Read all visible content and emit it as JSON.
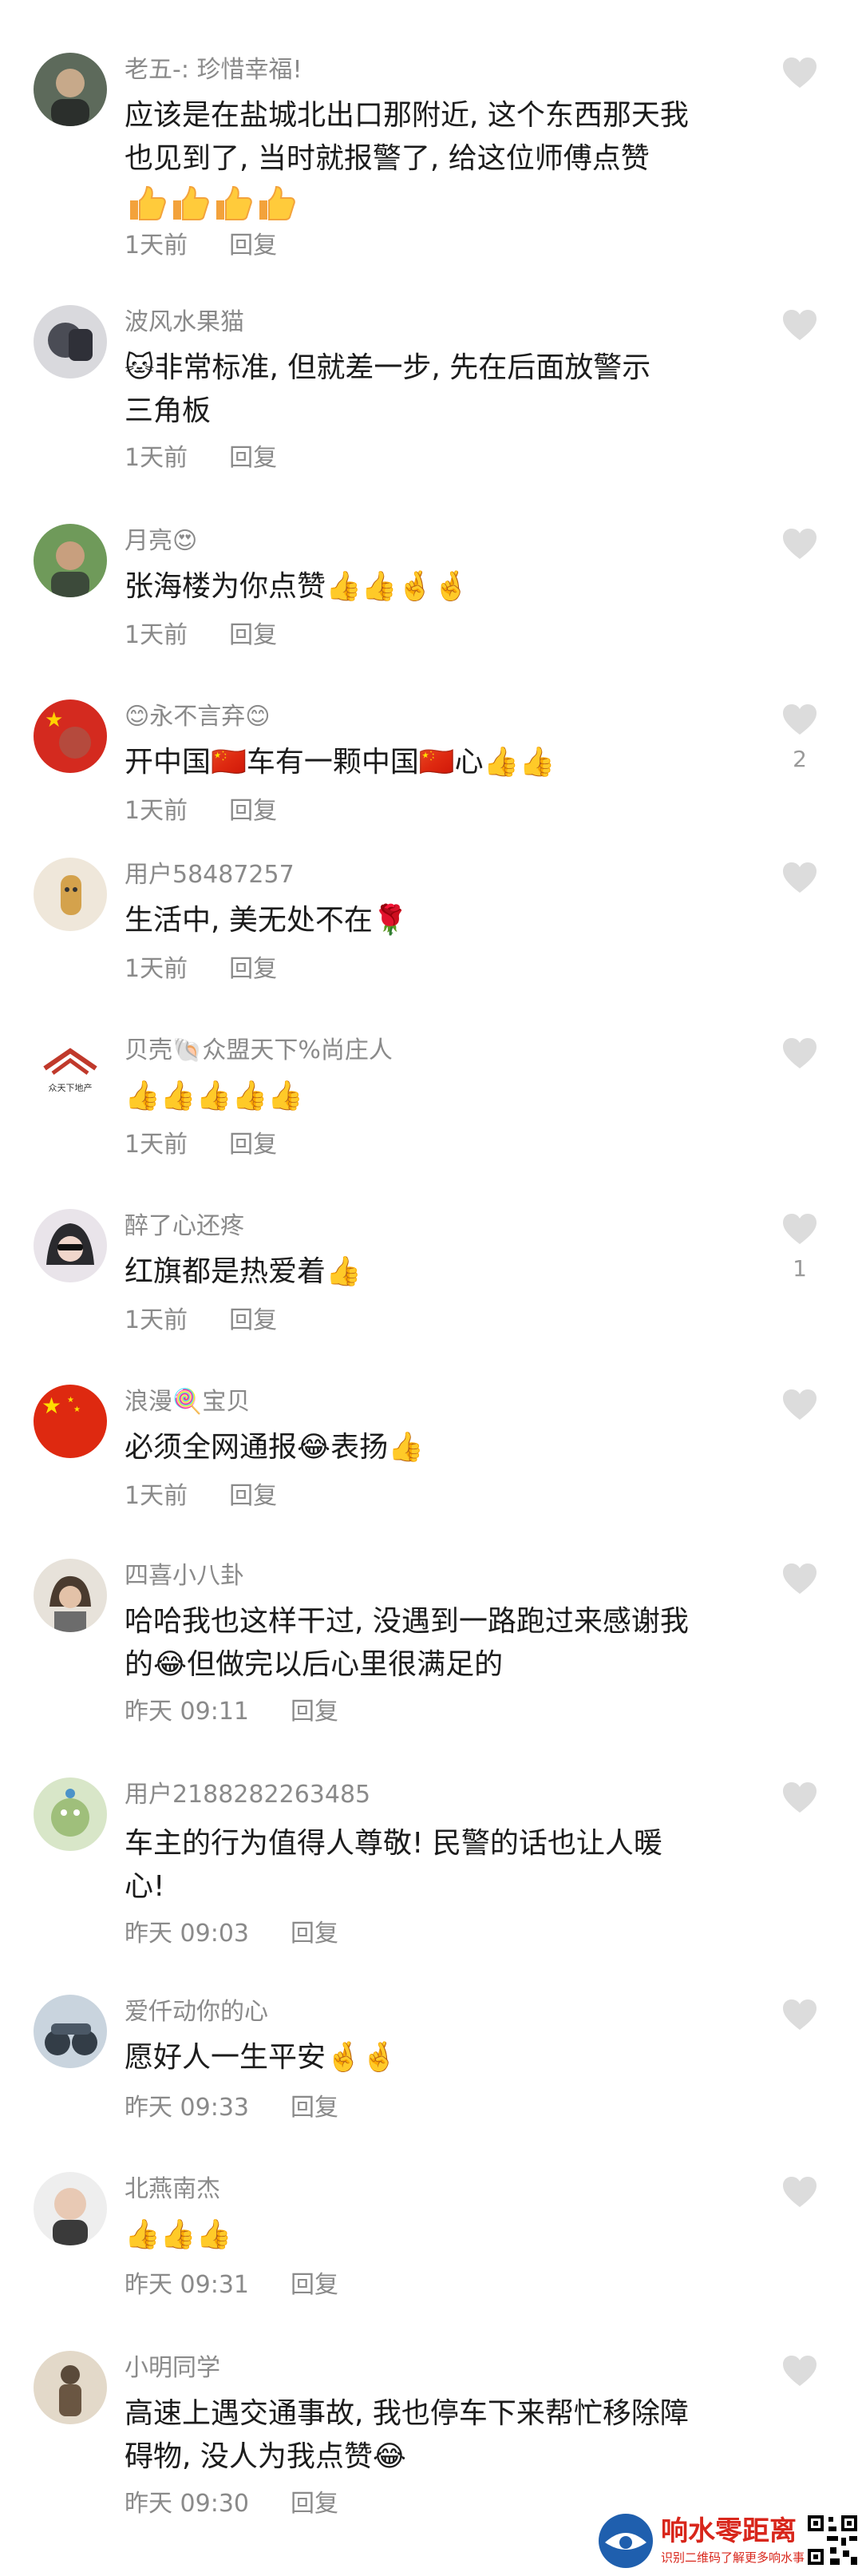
{
  "comments": [
    {
      "username": "老五-: 珍惜幸福!",
      "lines": [
        "应该是在盐城北出口那附近, 这个东西那天我",
        "也见到了, 当时就报警了, 给这位师傅点赞",
        "👍👍👍👍"
      ],
      "time": "1天前",
      "reply": "回复",
      "likes": ""
    },
    {
      "username": "波风水果猫",
      "lines": [
        "🐱非常标准, 但就差一步, 先在后面放警示",
        "三角板"
      ],
      "time": "1天前",
      "reply": "回复",
      "likes": ""
    },
    {
      "username": "月亮😍",
      "lines": [
        "张海楼为你点赞👍👍🤞🤞"
      ],
      "time": "1天前",
      "reply": "回复",
      "likes": ""
    },
    {
      "username": "😊永不言弃😊",
      "lines": [
        "开中国🇨🇳车有一颗中国🇨🇳心👍👍"
      ],
      "time": "1天前",
      "reply": "回复",
      "likes": "2"
    },
    {
      "username": "用户58487257",
      "lines": [
        "生活中, 美无处不在🌹"
      ],
      "time": "1天前",
      "reply": "回复",
      "likes": ""
    },
    {
      "username": "贝壳🐚众盟天下%尚庄人",
      "lines": [
        "👍👍👍👍👍"
      ],
      "time": "1天前",
      "reply": "回复",
      "likes": ""
    },
    {
      "username": "醉了心还疼",
      "lines": [
        "红旗都是热爱着👍"
      ],
      "time": "1天前",
      "reply": "回复",
      "likes": "1"
    },
    {
      "username": "浪漫🍭宝贝",
      "lines": [
        "必须全网通报😂表扬👍"
      ],
      "time": "1天前",
      "reply": "回复",
      "likes": ""
    },
    {
      "username": "四喜小八卦",
      "lines": [
        "哈哈我也这样干过, 没遇到一路跑过来感谢我",
        "的😂但做完以后心里很满足的"
      ],
      "time": "昨天 09:11",
      "reply": "回复",
      "likes": ""
    },
    {
      "username": "用户2188282263485",
      "lines": [
        "车主的行为值得人尊敬! 民警的话也让人暖",
        "心!"
      ],
      "time": "昨天 09:03",
      "reply": "回复",
      "likes": ""
    },
    {
      "username": "爱仟动你的心",
      "lines": [
        "愿好人一生平安🤞🤞"
      ],
      "time": "昨天 09:33",
      "reply": "回复",
      "likes": ""
    },
    {
      "username": "北燕南杰",
      "lines": [
        "👍👍👍"
      ],
      "time": "昨天 09:31",
      "reply": "回复",
      "likes": ""
    },
    {
      "username": "小明同学",
      "lines": [
        "高速上遇交通事故, 我也停车下来帮忙移除障",
        "碍物, 没人为我点赞😂"
      ],
      "time": "昨天 09:30",
      "reply": "回复",
      "likes": ""
    }
  ],
  "avatar_labels": {
    "shell_logo": "众天下地产"
  },
  "watermark": {
    "title": "响水零距离",
    "subtitle": "识别二维码了解更多响水事"
  },
  "colors": {
    "meta": "#8a8a8a",
    "text": "#1c1c1c",
    "heart_outline": "#dcdcdc",
    "watermark": "#d8261b"
  }
}
